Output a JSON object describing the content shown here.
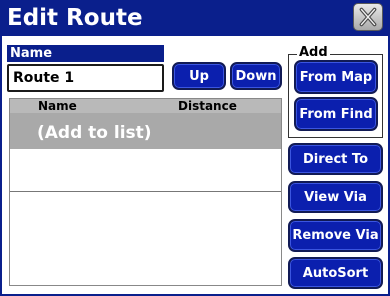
{
  "window": {
    "title": "Edit Route",
    "close_icon": "close-x-icon"
  },
  "name_field": {
    "label": "Name",
    "value": "Route 1"
  },
  "buttons": {
    "up": "Up",
    "down": "Down",
    "direct_to": "Direct To",
    "view_via": "View Via",
    "remove_via": "Remove Via",
    "autosort": "AutoSort"
  },
  "add_group": {
    "label": "Add",
    "from_map": "From Map",
    "from_find": "From Find"
  },
  "route_list": {
    "columns": [
      "Name",
      "Distance"
    ],
    "rows": [
      {
        "name": "(Add to list)",
        "distance": ""
      }
    ]
  },
  "colors": {
    "titlebar": "#0a1f8c",
    "button": "#0b1fae",
    "selected_row": "#a9a9a9"
  }
}
